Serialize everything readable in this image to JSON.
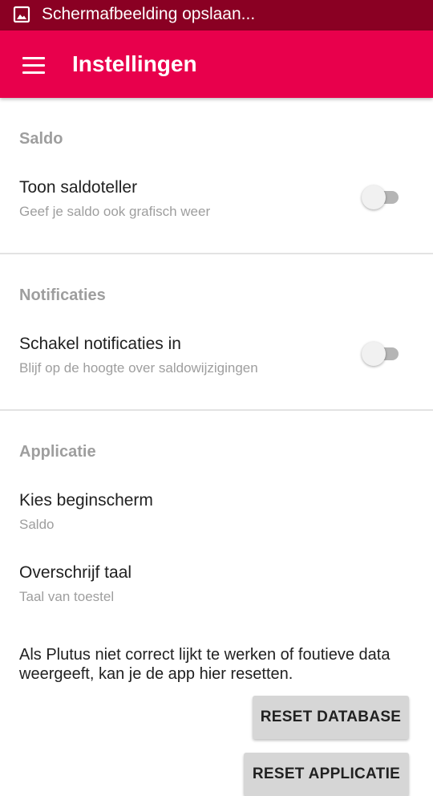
{
  "status_bar": {
    "notification_text": "Schermafbeelding opslaan...",
    "icon": "image-icon"
  },
  "app_bar": {
    "title": "Instellingen",
    "menu_icon": "hamburger-menu-icon",
    "color": "#e8004c"
  },
  "sections": {
    "saldo": {
      "header": "Saldo",
      "pref": {
        "title": "Toon saldoteller",
        "summary": "Geef je saldo ook grafisch weer",
        "enabled": false
      }
    },
    "notificaties": {
      "header": "Notificaties",
      "pref": {
        "title": "Schakel notificaties in",
        "summary": "Blijf op de hoogte over saldowijzigingen",
        "enabled": false
      }
    },
    "applicatie": {
      "header": "Applicatie",
      "start_screen": {
        "title": "Kies beginscherm",
        "summary": "Saldo"
      },
      "language": {
        "title": "Overschrijf taal",
        "summary": "Taal van toestel"
      },
      "info_text": "Als Plutus niet correct lijkt te werken of foutieve data weergeeft, kan je de app hier resetten.",
      "reset_database_label": "RESET DATABASE",
      "reset_app_label": "RESET APPLICATIE"
    }
  },
  "colors": {
    "status_bar": "#8a0023",
    "accent": "#e8004c",
    "section_header": "#9e9e9e"
  }
}
